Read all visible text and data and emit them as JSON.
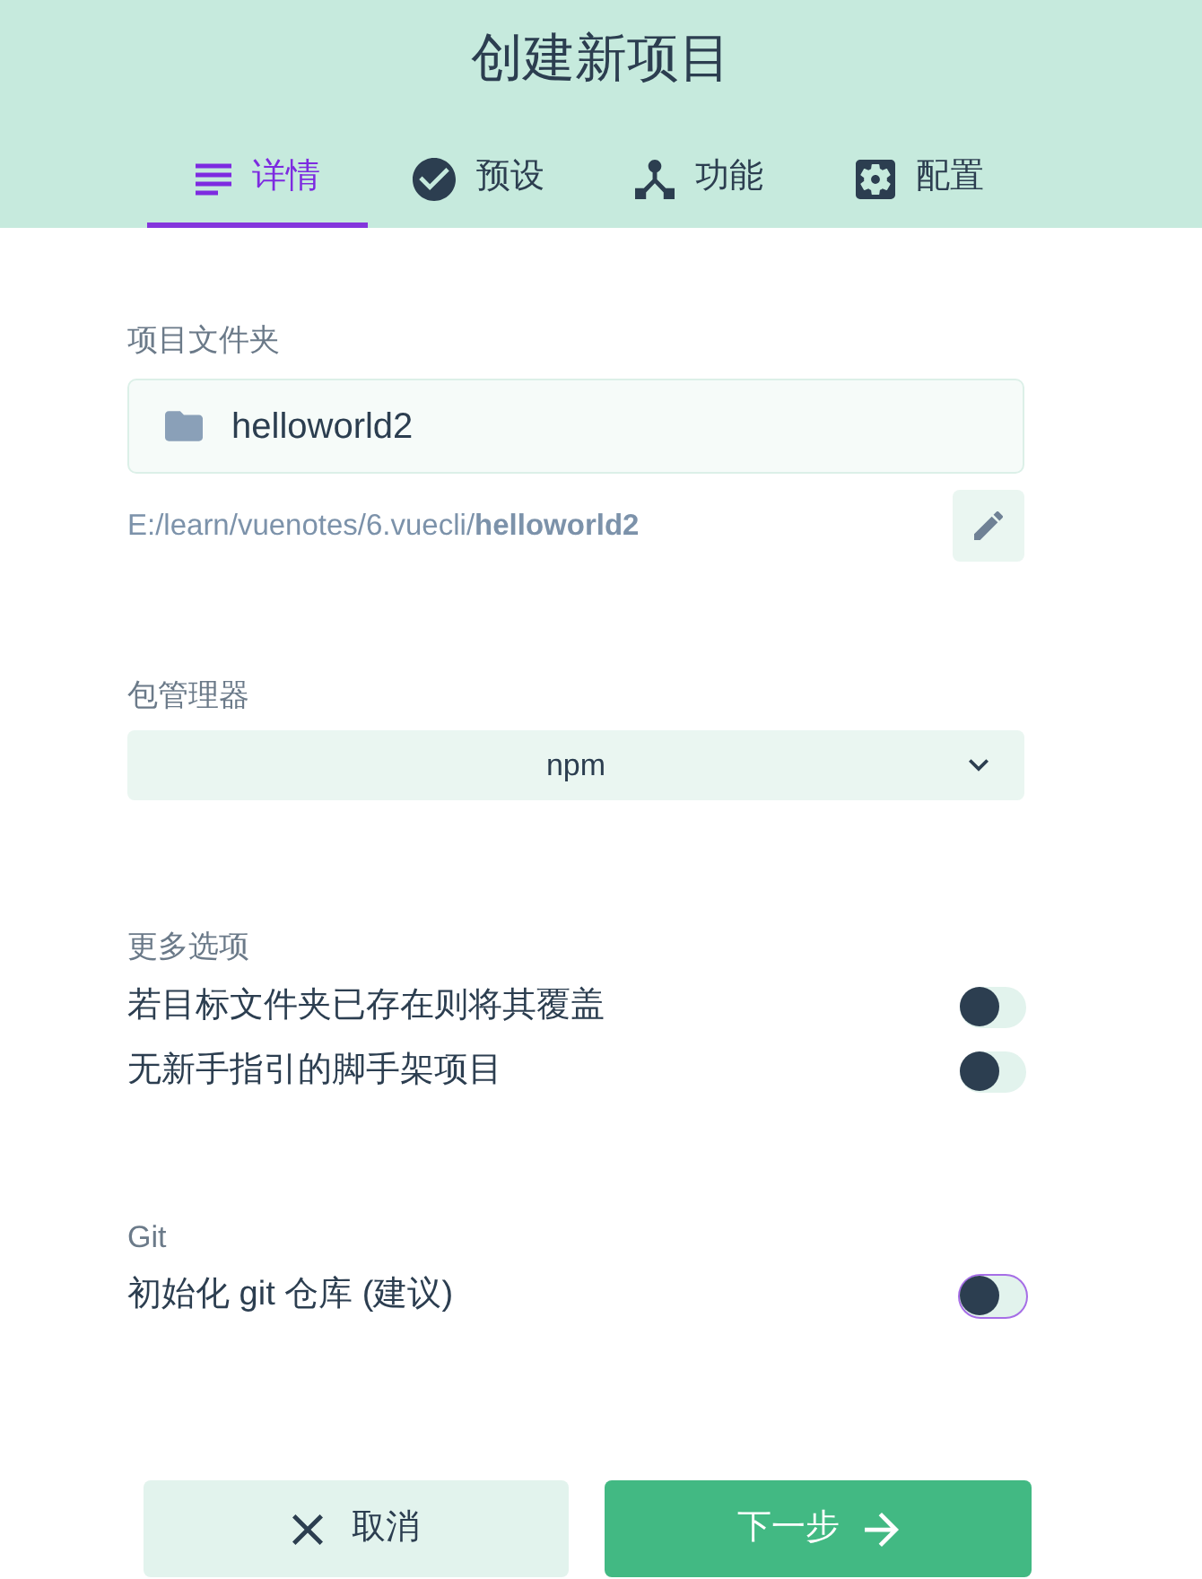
{
  "header": {
    "title": "创建新项目"
  },
  "tabs": [
    {
      "label": "详情",
      "selected": true
    },
    {
      "label": "预设",
      "selected": false
    },
    {
      "label": "功能",
      "selected": false
    },
    {
      "label": "配置",
      "selected": false
    }
  ],
  "project_folder": {
    "label": "项目文件夹",
    "value": "helloworld2",
    "path": "E:/learn/vuenotes/6.vuecli/**helloworld2**"
  },
  "package_manager": {
    "label": "包管理器",
    "value": "npm"
  },
  "more_options": {
    "label": "更多选项",
    "options": [
      {
        "label": "若目标文件夹已存在则将其覆盖",
        "on": false,
        "focused": false
      },
      {
        "label": "无新手指引的脚手架项目",
        "on": false,
        "focused": false
      }
    ]
  },
  "git": {
    "label": "Git",
    "options": [
      {
        "label": "初始化 git 仓库 (建议)",
        "on": false,
        "focused": true
      }
    ]
  },
  "buttons": [
    {
      "label": "取消",
      "kind": "cancel"
    },
    {
      "label": "下一步",
      "kind": "next"
    }
  ]
}
